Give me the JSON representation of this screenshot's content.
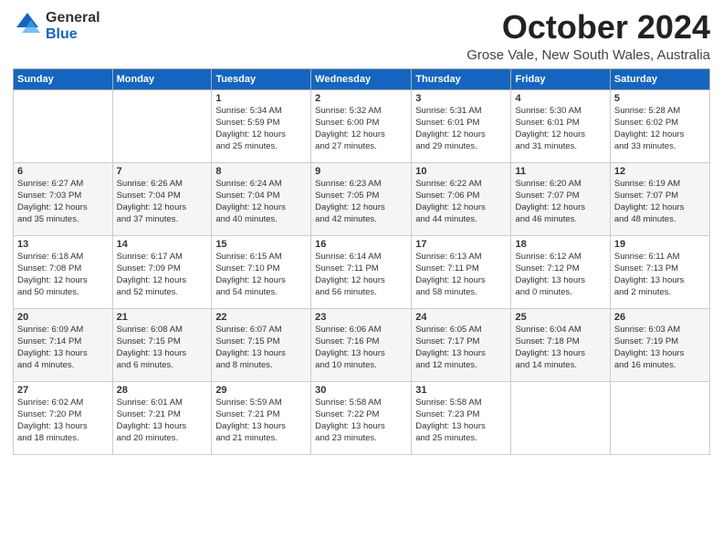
{
  "header": {
    "logo_general": "General",
    "logo_blue": "Blue",
    "title": "October 2024",
    "location": "Grose Vale, New South Wales, Australia"
  },
  "calendar": {
    "days_of_week": [
      "Sunday",
      "Monday",
      "Tuesday",
      "Wednesday",
      "Thursday",
      "Friday",
      "Saturday"
    ],
    "weeks": [
      [
        {
          "day": "",
          "info": ""
        },
        {
          "day": "",
          "info": ""
        },
        {
          "day": "1",
          "info": "Sunrise: 5:34 AM\nSunset: 5:59 PM\nDaylight: 12 hours\nand 25 minutes."
        },
        {
          "day": "2",
          "info": "Sunrise: 5:32 AM\nSunset: 6:00 PM\nDaylight: 12 hours\nand 27 minutes."
        },
        {
          "day": "3",
          "info": "Sunrise: 5:31 AM\nSunset: 6:01 PM\nDaylight: 12 hours\nand 29 minutes."
        },
        {
          "day": "4",
          "info": "Sunrise: 5:30 AM\nSunset: 6:01 PM\nDaylight: 12 hours\nand 31 minutes."
        },
        {
          "day": "5",
          "info": "Sunrise: 5:28 AM\nSunset: 6:02 PM\nDaylight: 12 hours\nand 33 minutes."
        }
      ],
      [
        {
          "day": "6",
          "info": "Sunrise: 6:27 AM\nSunset: 7:03 PM\nDaylight: 12 hours\nand 35 minutes."
        },
        {
          "day": "7",
          "info": "Sunrise: 6:26 AM\nSunset: 7:04 PM\nDaylight: 12 hours\nand 37 minutes."
        },
        {
          "day": "8",
          "info": "Sunrise: 6:24 AM\nSunset: 7:04 PM\nDaylight: 12 hours\nand 40 minutes."
        },
        {
          "day": "9",
          "info": "Sunrise: 6:23 AM\nSunset: 7:05 PM\nDaylight: 12 hours\nand 42 minutes."
        },
        {
          "day": "10",
          "info": "Sunrise: 6:22 AM\nSunset: 7:06 PM\nDaylight: 12 hours\nand 44 minutes."
        },
        {
          "day": "11",
          "info": "Sunrise: 6:20 AM\nSunset: 7:07 PM\nDaylight: 12 hours\nand 46 minutes."
        },
        {
          "day": "12",
          "info": "Sunrise: 6:19 AM\nSunset: 7:07 PM\nDaylight: 12 hours\nand 48 minutes."
        }
      ],
      [
        {
          "day": "13",
          "info": "Sunrise: 6:18 AM\nSunset: 7:08 PM\nDaylight: 12 hours\nand 50 minutes."
        },
        {
          "day": "14",
          "info": "Sunrise: 6:17 AM\nSunset: 7:09 PM\nDaylight: 12 hours\nand 52 minutes."
        },
        {
          "day": "15",
          "info": "Sunrise: 6:15 AM\nSunset: 7:10 PM\nDaylight: 12 hours\nand 54 minutes."
        },
        {
          "day": "16",
          "info": "Sunrise: 6:14 AM\nSunset: 7:11 PM\nDaylight: 12 hours\nand 56 minutes."
        },
        {
          "day": "17",
          "info": "Sunrise: 6:13 AM\nSunset: 7:11 PM\nDaylight: 12 hours\nand 58 minutes."
        },
        {
          "day": "18",
          "info": "Sunrise: 6:12 AM\nSunset: 7:12 PM\nDaylight: 13 hours\nand 0 minutes."
        },
        {
          "day": "19",
          "info": "Sunrise: 6:11 AM\nSunset: 7:13 PM\nDaylight: 13 hours\nand 2 minutes."
        }
      ],
      [
        {
          "day": "20",
          "info": "Sunrise: 6:09 AM\nSunset: 7:14 PM\nDaylight: 13 hours\nand 4 minutes."
        },
        {
          "day": "21",
          "info": "Sunrise: 6:08 AM\nSunset: 7:15 PM\nDaylight: 13 hours\nand 6 minutes."
        },
        {
          "day": "22",
          "info": "Sunrise: 6:07 AM\nSunset: 7:15 PM\nDaylight: 13 hours\nand 8 minutes."
        },
        {
          "day": "23",
          "info": "Sunrise: 6:06 AM\nSunset: 7:16 PM\nDaylight: 13 hours\nand 10 minutes."
        },
        {
          "day": "24",
          "info": "Sunrise: 6:05 AM\nSunset: 7:17 PM\nDaylight: 13 hours\nand 12 minutes."
        },
        {
          "day": "25",
          "info": "Sunrise: 6:04 AM\nSunset: 7:18 PM\nDaylight: 13 hours\nand 14 minutes."
        },
        {
          "day": "26",
          "info": "Sunrise: 6:03 AM\nSunset: 7:19 PM\nDaylight: 13 hours\nand 16 minutes."
        }
      ],
      [
        {
          "day": "27",
          "info": "Sunrise: 6:02 AM\nSunset: 7:20 PM\nDaylight: 13 hours\nand 18 minutes."
        },
        {
          "day": "28",
          "info": "Sunrise: 6:01 AM\nSunset: 7:21 PM\nDaylight: 13 hours\nand 20 minutes."
        },
        {
          "day": "29",
          "info": "Sunrise: 5:59 AM\nSunset: 7:21 PM\nDaylight: 13 hours\nand 21 minutes."
        },
        {
          "day": "30",
          "info": "Sunrise: 5:58 AM\nSunset: 7:22 PM\nDaylight: 13 hours\nand 23 minutes."
        },
        {
          "day": "31",
          "info": "Sunrise: 5:58 AM\nSunset: 7:23 PM\nDaylight: 13 hours\nand 25 minutes."
        },
        {
          "day": "",
          "info": ""
        },
        {
          "day": "",
          "info": ""
        }
      ]
    ]
  }
}
